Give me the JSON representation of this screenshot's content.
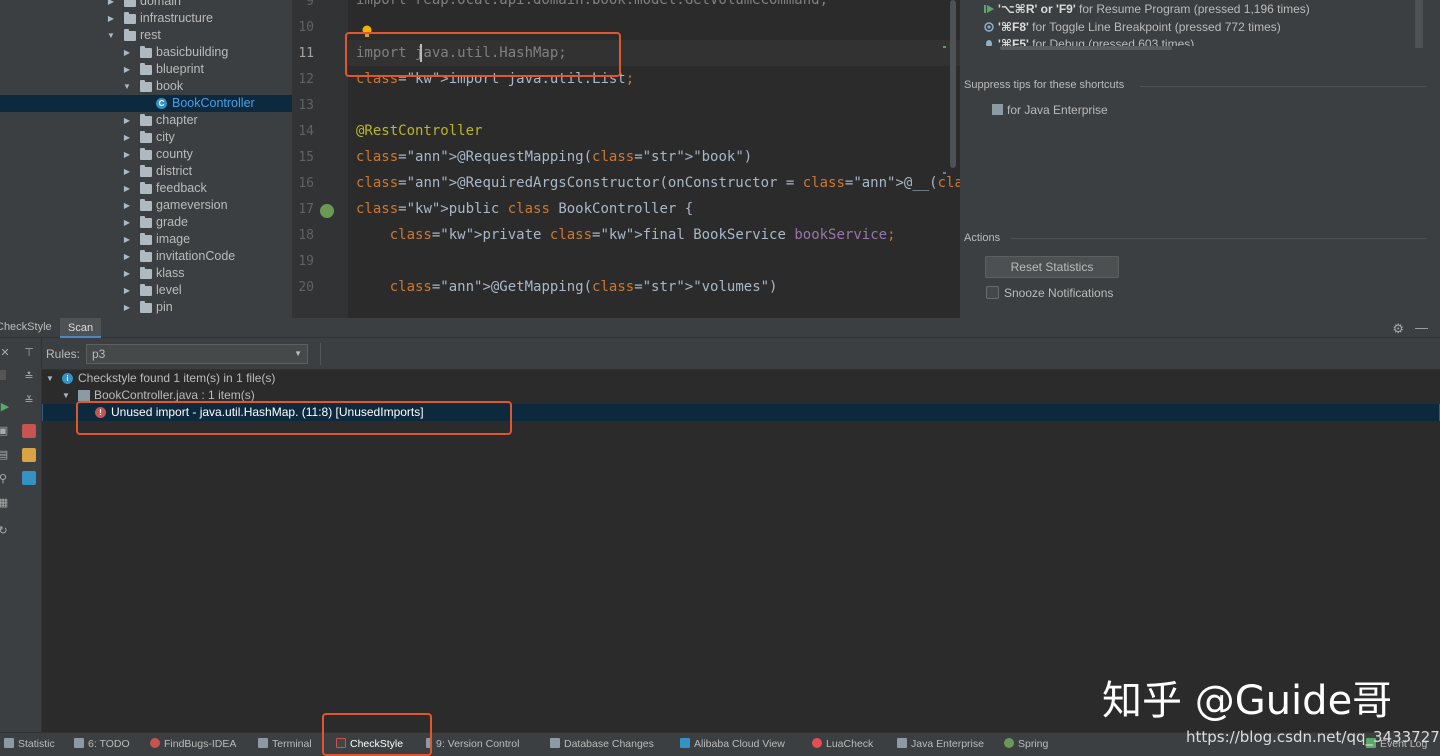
{
  "project_tree": {
    "items": [
      {
        "label": "domain",
        "type": "folder",
        "expanded": false
      },
      {
        "label": "infrastructure",
        "type": "folder",
        "expanded": false
      },
      {
        "label": "rest",
        "type": "folder",
        "expanded": true
      },
      {
        "label": "basicbuilding",
        "type": "folder",
        "expanded": false
      },
      {
        "label": "blueprint",
        "type": "folder",
        "expanded": false
      },
      {
        "label": "book",
        "type": "folder",
        "expanded": true
      },
      {
        "label": "BookController",
        "type": "class",
        "selected": true
      },
      {
        "label": "chapter",
        "type": "folder",
        "expanded": false
      },
      {
        "label": "city",
        "type": "folder",
        "expanded": false
      },
      {
        "label": "county",
        "type": "folder",
        "expanded": false
      },
      {
        "label": "district",
        "type": "folder",
        "expanded": false
      },
      {
        "label": "feedback",
        "type": "folder",
        "expanded": false
      },
      {
        "label": "gameversion",
        "type": "folder",
        "expanded": false
      },
      {
        "label": "grade",
        "type": "folder",
        "expanded": false
      },
      {
        "label": "image",
        "type": "folder",
        "expanded": false
      },
      {
        "label": "invitationCode",
        "type": "folder",
        "expanded": false
      },
      {
        "label": "klass",
        "type": "folder",
        "expanded": false
      },
      {
        "label": "level",
        "type": "folder",
        "expanded": false
      },
      {
        "label": "pin",
        "type": "folder",
        "expanded": false
      }
    ]
  },
  "editor": {
    "current_line": "11",
    "lines": [
      {
        "num": "9",
        "code": "import reap.ocat.api.domain.book.model.GetVolumeCommand;"
      },
      {
        "num": "10",
        "code": ""
      },
      {
        "num": "11",
        "code": "import java.util.HashMap;"
      },
      {
        "num": "12",
        "code": "import java.util.List;"
      },
      {
        "num": "13",
        "code": ""
      },
      {
        "num": "14",
        "code": "@RestController"
      },
      {
        "num": "15",
        "code": "@RequestMapping(\"book\")"
      },
      {
        "num": "16",
        "code": "@RequiredArgsConstructor(onConstructor = @__(@Autowired))"
      },
      {
        "num": "17",
        "code": "public class BookController {"
      },
      {
        "num": "18",
        "code": "    private final BookService bookService;"
      },
      {
        "num": "19",
        "code": ""
      },
      {
        "num": "20",
        "code": "    @GetMapping(\"volumes\")"
      }
    ]
  },
  "right_panel": {
    "tips": [
      {
        "shortcut": "'⌥⌘R' or 'F9'",
        "text": " for Resume Program (pressed 1,196 times)"
      },
      {
        "shortcut": "'⌘F8'",
        "text": " for Toggle Line Breakpoint (pressed 772 times)"
      },
      {
        "shortcut": "'⌘F5'",
        "text": " for Debug (pressed 603 times)"
      }
    ],
    "suppress_label": "Suppress tips for these shortcuts",
    "suppress_item": "for Java Enterprise",
    "actions_label": "Actions",
    "reset_button": "Reset Statistics",
    "snooze_label": "Snooze Notifications"
  },
  "tool_window": {
    "title": "CheckStyle",
    "tab": "Scan",
    "rules_label": "Rules:",
    "rules_value": "p3",
    "summary": "Checkstyle found 1 item(s) in 1 file(s)",
    "file_node": "BookController.java : 1 item(s)",
    "issue": "Unused import - java.util.HashMap. (11:8) [UnusedImports]"
  },
  "status_bar": {
    "items": [
      {
        "label": "Statistic",
        "icon": "statistic-icon"
      },
      {
        "label": "6: TODO",
        "icon": "todo-icon"
      },
      {
        "label": "FindBugs-IDEA",
        "icon": "bug-icon"
      },
      {
        "label": "Terminal",
        "icon": "terminal-icon"
      },
      {
        "label": "CheckStyle",
        "icon": "checkstyle-icon",
        "active": true
      },
      {
        "label": "9: Version Control",
        "icon": "vcs-icon"
      },
      {
        "label": "Database Changes",
        "icon": "database-icon"
      },
      {
        "label": "Alibaba Cloud View",
        "icon": "cloud-icon"
      },
      {
        "label": "LuaCheck",
        "icon": "lua-icon"
      },
      {
        "label": "Java Enterprise",
        "icon": "enterprise-icon"
      },
      {
        "label": "Spring",
        "icon": "spring-icon"
      },
      {
        "label": "Event Log",
        "icon": "event-log-icon"
      }
    ]
  },
  "watermark": {
    "main": "知乎 @Guide哥",
    "url": "https://blog.csdn.net/qq_34337272"
  },
  "colors": {
    "highlight": "#e0562f",
    "selection": "#0d293e",
    "accent": "#4a88c7"
  }
}
